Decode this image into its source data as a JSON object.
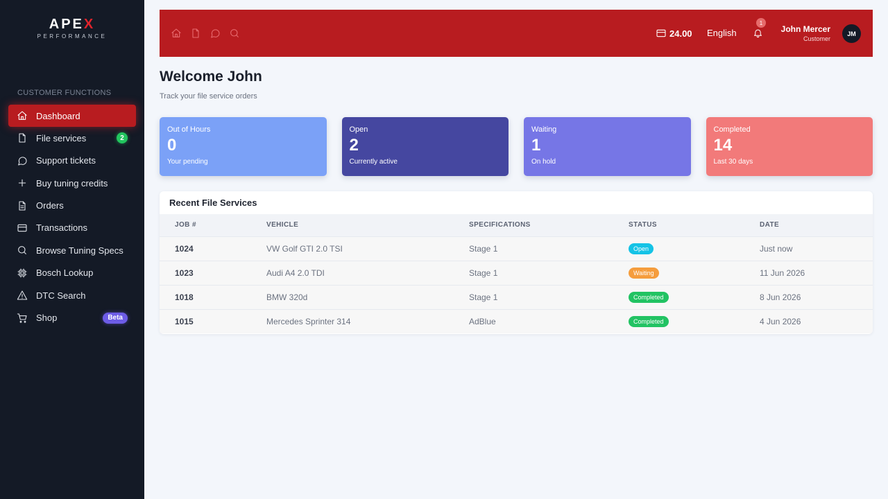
{
  "brand": {
    "name_main": "APE",
    "name_accent": "X",
    "tagline": "PERFORMANCE",
    "accent_color": "#e0242c"
  },
  "sidebar": {
    "section_label": "CUSTOMER FUNCTIONS",
    "items": [
      {
        "label": "Dashboard",
        "icon": "home-icon",
        "active": true
      },
      {
        "label": "File services",
        "icon": "file-icon",
        "badge": "2"
      },
      {
        "label": "Support tickets",
        "icon": "chat-icon"
      },
      {
        "label": "Buy tuning credits",
        "icon": "plus-icon"
      },
      {
        "label": "Orders",
        "icon": "document-icon"
      },
      {
        "label": "Transactions",
        "icon": "credit-card-icon"
      },
      {
        "label": "Browse Tuning Specs",
        "icon": "search-icon"
      },
      {
        "label": "Bosch Lookup",
        "icon": "chip-icon"
      },
      {
        "label": "DTC Search",
        "icon": "warning-icon"
      },
      {
        "label": "Shop",
        "icon": "cart-icon",
        "badge": "Beta"
      }
    ]
  },
  "header": {
    "icons": [
      "home-icon",
      "file-icon",
      "chat-icon",
      "search-icon"
    ],
    "credits": "24.00",
    "language": "English",
    "notification_count": "1",
    "user_name": "John Mercer",
    "user_role": "Customer",
    "avatar_initials": "JM",
    "background": "#b81c20"
  },
  "main": {
    "title": "Welcome John",
    "subtitle": "Track your file service orders",
    "cards": [
      {
        "label": "Out of Hours",
        "value": "0",
        "note": "Your pending",
        "color": "#7ba1f7"
      },
      {
        "label": "Open",
        "value": "2",
        "note": "Currently active",
        "color": "#4547a0"
      },
      {
        "label": "Waiting",
        "value": "1",
        "note": "On hold",
        "color": "#7676e6"
      },
      {
        "label": "Completed",
        "value": "14",
        "note": "Last 30 days",
        "color": "#f27a7a"
      }
    ],
    "table": {
      "title": "Recent File Services",
      "columns": [
        "JOB #",
        "VEHICLE",
        "SPECIFICATIONS",
        "STATUS",
        "DATE"
      ],
      "rows": [
        {
          "job": "1024",
          "vehicle": "VW Golf GTI 2.0 TSI",
          "spec": "Stage 1",
          "status": "Open",
          "status_color": "#15c3e6",
          "date": "Just now"
        },
        {
          "job": "1023",
          "vehicle": "Audi A4 2.0 TDI",
          "spec": "Stage 1",
          "status": "Waiting",
          "status_color": "#f59d3d",
          "date": "11 Jun 2026"
        },
        {
          "job": "1018",
          "vehicle": "BMW 320d",
          "spec": "Stage 1",
          "status": "Completed",
          "status_color": "#22c363",
          "date": "8 Jun 2026"
        },
        {
          "job": "1015",
          "vehicle": "Mercedes Sprinter 314",
          "spec": "AdBlue",
          "status": "Completed",
          "status_color": "#22c363",
          "date": "4 Jun 2026"
        }
      ]
    }
  }
}
